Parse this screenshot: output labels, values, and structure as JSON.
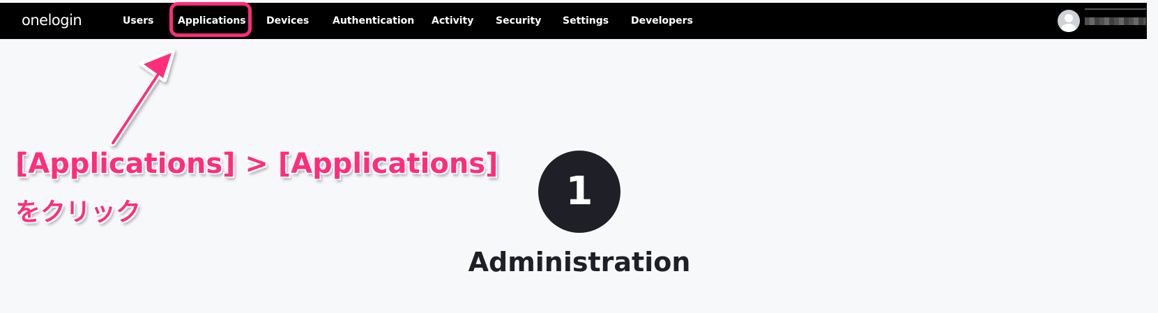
{
  "header": {
    "logo": "onelogin",
    "nav": [
      {
        "label": "Users"
      },
      {
        "label": "Applications"
      },
      {
        "label": "Devices"
      },
      {
        "label": "Authentication"
      },
      {
        "label": "Activity"
      },
      {
        "label": "Security"
      },
      {
        "label": "Settings"
      },
      {
        "label": "Developers"
      }
    ],
    "user_menu": {
      "avatar_icon": "user-avatar-icon"
    }
  },
  "annotation": {
    "line1": "[Applications] > [Applications]",
    "line2": "をクリック",
    "color": "#ff2d7a"
  },
  "step": {
    "number": "1",
    "title": "Administration"
  },
  "colors": {
    "header_bg": "#000000",
    "page_bg": "#f7f8fa",
    "step_circle": "#1e1f27",
    "highlight": "#ff2d7a"
  }
}
